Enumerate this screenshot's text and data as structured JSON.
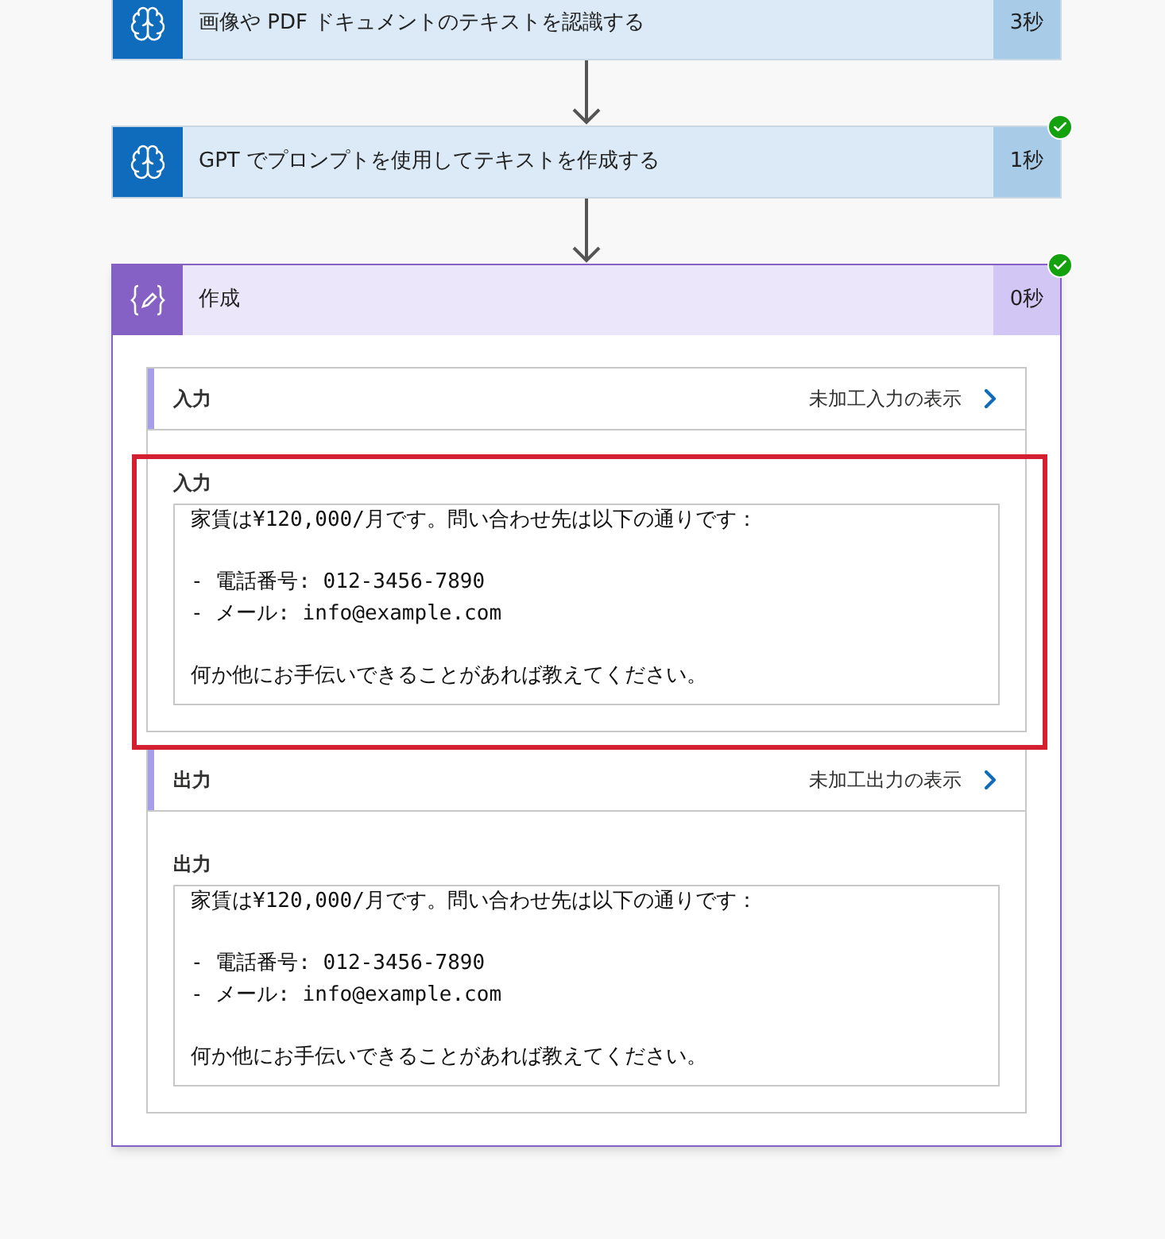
{
  "steps": [
    {
      "kind": "ai",
      "title": "画像や PDF ドキュメントのテキストを認識する",
      "duration": "3秒",
      "succeeded": false,
      "expanded": false
    },
    {
      "kind": "ai",
      "title": "GPT でプロンプトを使用してテキストを作成する",
      "duration": "1秒",
      "succeeded": true,
      "expanded": false
    },
    {
      "kind": "compose",
      "title": "作成",
      "duration": "0秒",
      "succeeded": true,
      "expanded": true,
      "sections": [
        {
          "heading": "入力",
          "link": "未加工入力の表示",
          "field_label": "入力",
          "value": "家賃は¥120,000/月です。問い合わせ先は以下の通りです：\n\n- 電話番号: 012-3456-7890\n- メール: info@example.com\n\n何か他にお手伝いできることがあれば教えてください。",
          "highlighted": true
        },
        {
          "heading": "出力",
          "link": "未加工出力の表示",
          "field_label": "出力",
          "value": "家賃は¥120,000/月です。問い合わせ先は以下の通りです：\n\n- 電話番号: 012-3456-7890\n- メール: info@example.com\n\n何か他にお手伝いできることがあれば教えてください。",
          "highlighted": false
        }
      ]
    }
  ]
}
